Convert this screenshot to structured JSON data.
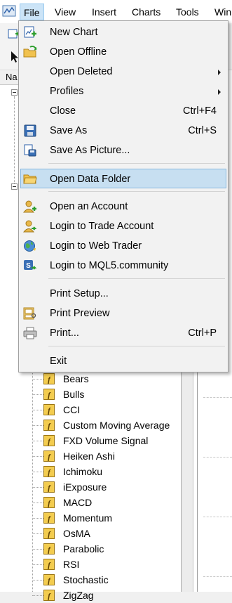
{
  "menubar": {
    "items": [
      "File",
      "View",
      "Insert",
      "Charts",
      "Tools",
      "Win"
    ]
  },
  "navigator": {
    "header_label": "Na",
    "indicators": [
      "Bears",
      "Bulls",
      "CCI",
      "Custom Moving Average",
      "FXD Volume Signal",
      "Heiken Ashi",
      "Ichimoku",
      "iExposure",
      "MACD",
      "Momentum",
      "OsMA",
      "Parabolic",
      "RSI",
      "Stochastic",
      "ZigZag"
    ]
  },
  "file_menu": {
    "items": [
      {
        "label": "New Chart",
        "shortcut": "",
        "icon": "new-chart-icon",
        "submenu": false
      },
      {
        "label": "Open Offline",
        "shortcut": "",
        "icon": "open-offline-folder-icon",
        "submenu": false
      },
      {
        "label": "Open Deleted",
        "shortcut": "",
        "icon": "",
        "submenu": true
      },
      {
        "label": "Profiles",
        "shortcut": "",
        "icon": "",
        "submenu": true
      },
      {
        "label": "Close",
        "shortcut": "Ctrl+F4",
        "icon": "",
        "submenu": false
      },
      {
        "label": "Save As",
        "shortcut": "Ctrl+S",
        "icon": "floppy-disk-icon",
        "submenu": false
      },
      {
        "label": "Save As Picture...",
        "shortcut": "",
        "icon": "save-picture-icon",
        "submenu": false
      },
      {
        "label": "Open Data Folder",
        "shortcut": "",
        "icon": "folder-icon",
        "submenu": false
      },
      {
        "label": "Open an Account",
        "shortcut": "",
        "icon": "user-add-icon",
        "submenu": false
      },
      {
        "label": "Login to Trade Account",
        "shortcut": "",
        "icon": "user-login-icon",
        "submenu": false
      },
      {
        "label": "Login to Web Trader",
        "shortcut": "",
        "icon": "globe-icon",
        "submenu": false
      },
      {
        "label": "Login to MQL5.community",
        "shortcut": "",
        "icon": "mql5-icon",
        "submenu": false
      },
      {
        "label": "Print Setup...",
        "shortcut": "",
        "icon": "",
        "submenu": false
      },
      {
        "label": "Print Preview",
        "shortcut": "",
        "icon": "print-preview-icon",
        "submenu": false
      },
      {
        "label": "Print...",
        "shortcut": "Ctrl+P",
        "icon": "printer-icon",
        "submenu": false
      },
      {
        "label": "Exit",
        "shortcut": "",
        "icon": "",
        "submenu": false
      }
    ],
    "highlighted": "Open Data Folder"
  },
  "colors": {
    "menu_highlight": "#c7dff1",
    "menu_highlight_border": "#87b7df",
    "menubar_active": "#cce4f7"
  }
}
